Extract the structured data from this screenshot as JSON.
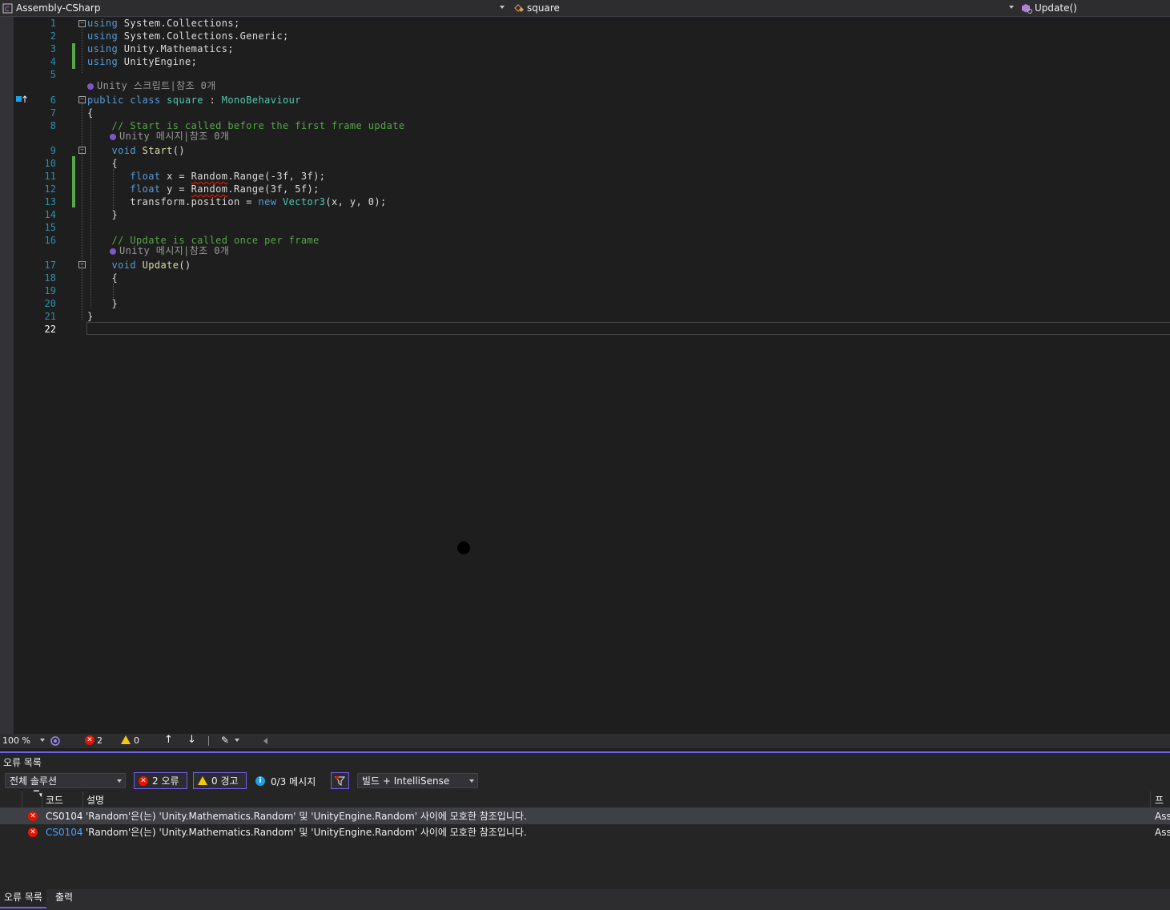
{
  "nav": {
    "project": "Assembly-CSharp",
    "class": "square",
    "member": "Update()"
  },
  "code": {
    "lines": [
      {
        "n": "1",
        "parts": [
          {
            "c": "kw",
            "t": "using"
          },
          {
            "c": "ns",
            "t": " System.Collections;"
          }
        ]
      },
      {
        "n": "2",
        "parts": [
          {
            "c": "kw",
            "t": "using"
          },
          {
            "c": "ns",
            "t": " System.Collections.Generic;"
          }
        ]
      },
      {
        "n": "3",
        "parts": [
          {
            "c": "kw",
            "t": "using"
          },
          {
            "c": "ns",
            "t": " Unity.Mathematics;"
          }
        ]
      },
      {
        "n": "4",
        "parts": [
          {
            "c": "kw",
            "t": "using"
          },
          {
            "c": "ns",
            "t": " UnityEngine;"
          }
        ]
      },
      {
        "n": "5",
        "parts": []
      },
      {
        "n": "6",
        "parts": [
          {
            "c": "kw",
            "t": "public class "
          },
          {
            "c": "tp",
            "t": "square"
          },
          {
            "c": "ns",
            "t": " : "
          },
          {
            "c": "tp",
            "t": "MonoBehaviour"
          }
        ]
      },
      {
        "n": "7",
        "parts": [
          {
            "c": "ns",
            "t": "{"
          }
        ]
      },
      {
        "n": "8",
        "parts": [
          {
            "c": "cm",
            "t": "    // Start is called before the first frame update"
          }
        ]
      },
      {
        "n": "9",
        "parts": [
          {
            "c": "ns",
            "t": "    "
          },
          {
            "c": "kw",
            "t": "void"
          },
          {
            "c": "ns",
            "t": " "
          },
          {
            "c": "fn",
            "t": "Start"
          },
          {
            "c": "ns",
            "t": "()"
          }
        ]
      },
      {
        "n": "10",
        "parts": [
          {
            "c": "ns",
            "t": "    {"
          }
        ]
      },
      {
        "n": "11",
        "parts": [
          {
            "c": "ns",
            "t": "       "
          },
          {
            "c": "kw",
            "t": "float"
          },
          {
            "c": "ns",
            "t": " x = "
          },
          {
            "c": "sq",
            "t": "Random"
          },
          {
            "c": "ns",
            "t": ".Range(-3f, 3f);"
          }
        ]
      },
      {
        "n": "12",
        "parts": [
          {
            "c": "ns",
            "t": "       "
          },
          {
            "c": "kw",
            "t": "float"
          },
          {
            "c": "ns",
            "t": " y = "
          },
          {
            "c": "sq",
            "t": "Random"
          },
          {
            "c": "ns",
            "t": ".Range(3f, 5f);"
          }
        ]
      },
      {
        "n": "13",
        "parts": [
          {
            "c": "ns",
            "t": "       transform.position = "
          },
          {
            "c": "kw",
            "t": "new"
          },
          {
            "c": "ns",
            "t": " "
          },
          {
            "c": "tp",
            "t": "Vector3"
          },
          {
            "c": "ns",
            "t": "(x, y, 0);"
          }
        ]
      },
      {
        "n": "14",
        "parts": [
          {
            "c": "ns",
            "t": "    }"
          }
        ]
      },
      {
        "n": "15",
        "parts": []
      },
      {
        "n": "16",
        "parts": [
          {
            "c": "cm",
            "t": "    // Update is called once per frame"
          }
        ]
      },
      {
        "n": "17",
        "parts": [
          {
            "c": "ns",
            "t": "    "
          },
          {
            "c": "kw",
            "t": "void"
          },
          {
            "c": "ns",
            "t": " "
          },
          {
            "c": "fn",
            "t": "Update"
          },
          {
            "c": "ns",
            "t": "()"
          }
        ]
      },
      {
        "n": "18",
        "parts": [
          {
            "c": "ns",
            "t": "    {"
          }
        ]
      },
      {
        "n": "19",
        "parts": []
      },
      {
        "n": "20",
        "parts": [
          {
            "c": "ns",
            "t": "    }"
          }
        ]
      },
      {
        "n": "21",
        "parts": [
          {
            "c": "ns",
            "t": "}"
          }
        ]
      },
      {
        "n": "22",
        "parts": []
      }
    ],
    "lens_script": "Unity 스크립트|참조 0개",
    "lens_message": "Unity 메시지|참조 0개"
  },
  "status": {
    "zoom": "100 %",
    "errors": "2",
    "warnings": "0"
  },
  "errorlist": {
    "title": "오류 목록",
    "scope": "전체 솔루션",
    "errors_btn": "2 오류",
    "warnings_btn": "0 경고",
    "messages_btn": "0/3 메시지",
    "build_filter": "빌드 + IntelliSense",
    "col_code": "코드",
    "col_desc": "설명",
    "col_project": "프로",
    "rows": [
      {
        "code": "CS0104",
        "desc": "'Random'은(는) 'Unity.Mathematics.Random' 및 'UnityEngine.Random' 사이에 모호한 참조입니다.",
        "project": "Ass"
      },
      {
        "code": "CS0104",
        "desc": "'Random'은(는) 'Unity.Mathematics.Random' 및 'UnityEngine.Random' 사이에 모호한 참조입니다.",
        "project": "Ass"
      }
    ]
  },
  "tabs": {
    "errorlist": "오류 목록",
    "output": "출력"
  }
}
